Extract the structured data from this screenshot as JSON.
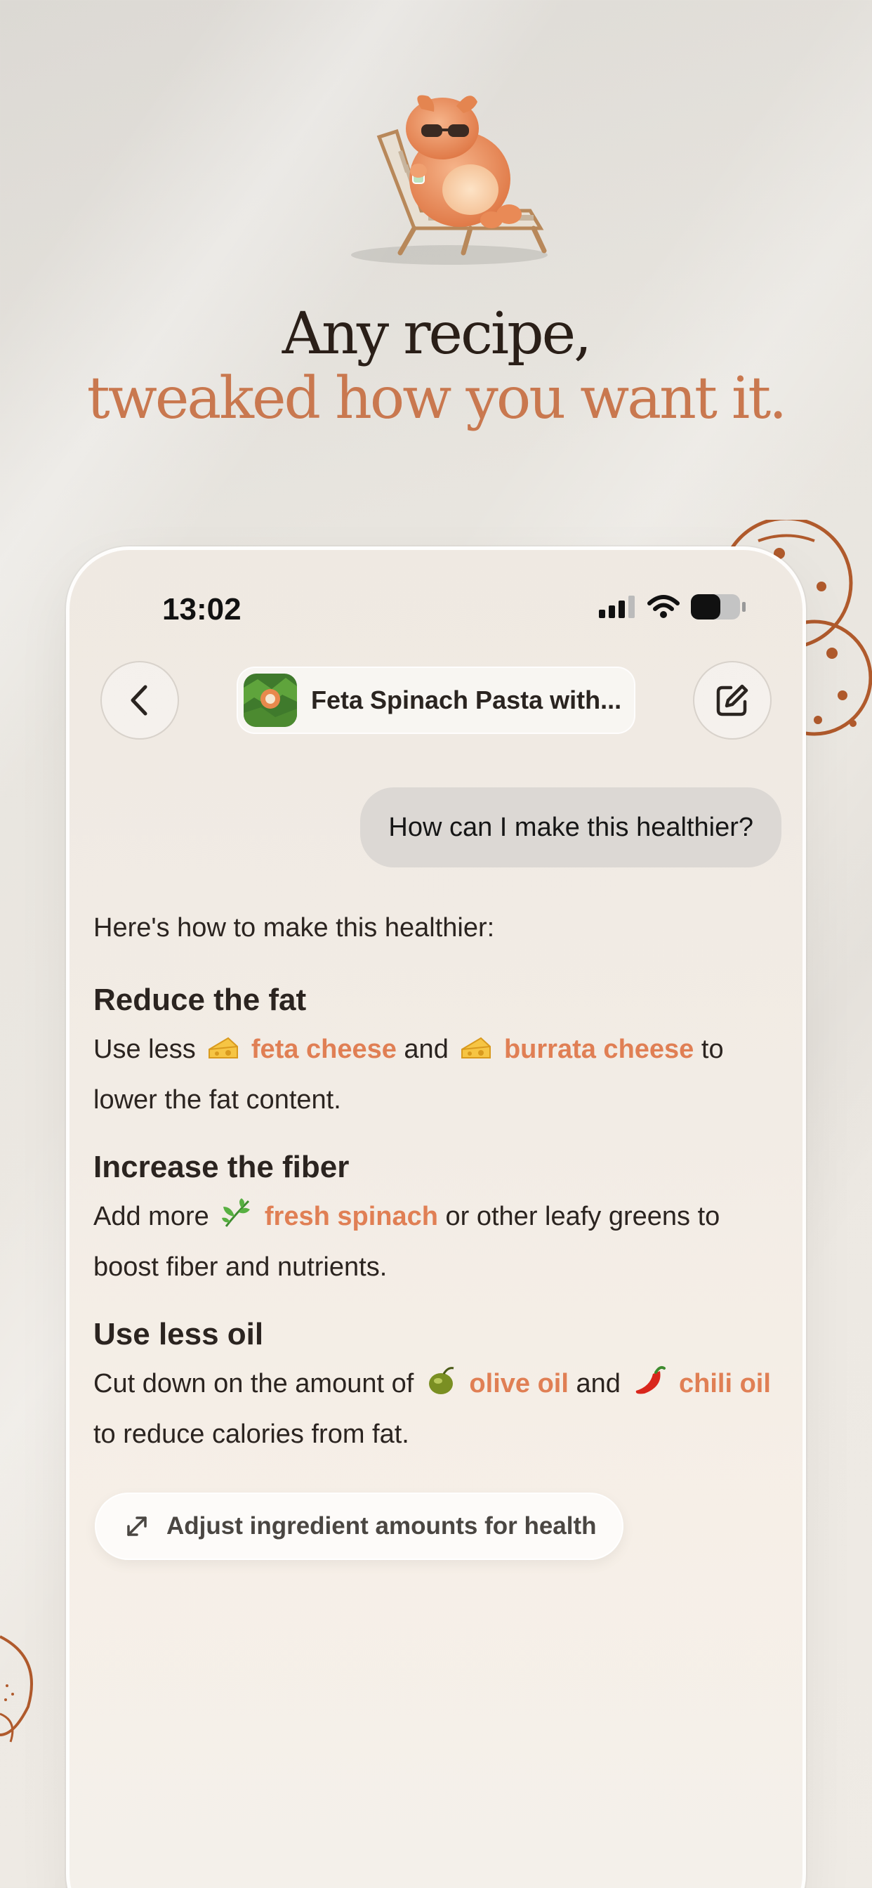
{
  "hero": {
    "headline_line1": "Any recipe,",
    "headline_line2": "tweaked how you want it."
  },
  "status_bar": {
    "time": "13:02"
  },
  "nav": {
    "recipe_title": "Feta Spinach Pasta with..."
  },
  "chat": {
    "user_message": "How can I make this healthier?",
    "intro": "Here's how to make this healthier:",
    "sections": [
      {
        "title": "Reduce the fat",
        "text_1": "Use less",
        "ingredient_1": "feta cheese",
        "text_2": "and",
        "ingredient_2": "burrata cheese",
        "text_3": "to lower the fat content."
      },
      {
        "title": "Increase the fiber",
        "text_1": "Add more",
        "ingredient_1": "fresh spinach",
        "text_2": "or other leafy greens to boost fiber and nutrients."
      },
      {
        "title": "Use less oil",
        "text_1": "Cut down on the amount of",
        "ingredient_1": "olive oil",
        "text_2": "and",
        "ingredient_2": "chili oil",
        "text_3": "to reduce calories from fat."
      }
    ],
    "suggestion": "Adjust ingredient amounts for health"
  },
  "colors": {
    "accent": "#e07f54",
    "headline_accent": "#c9784f",
    "headline_dark": "#2a1f18"
  }
}
